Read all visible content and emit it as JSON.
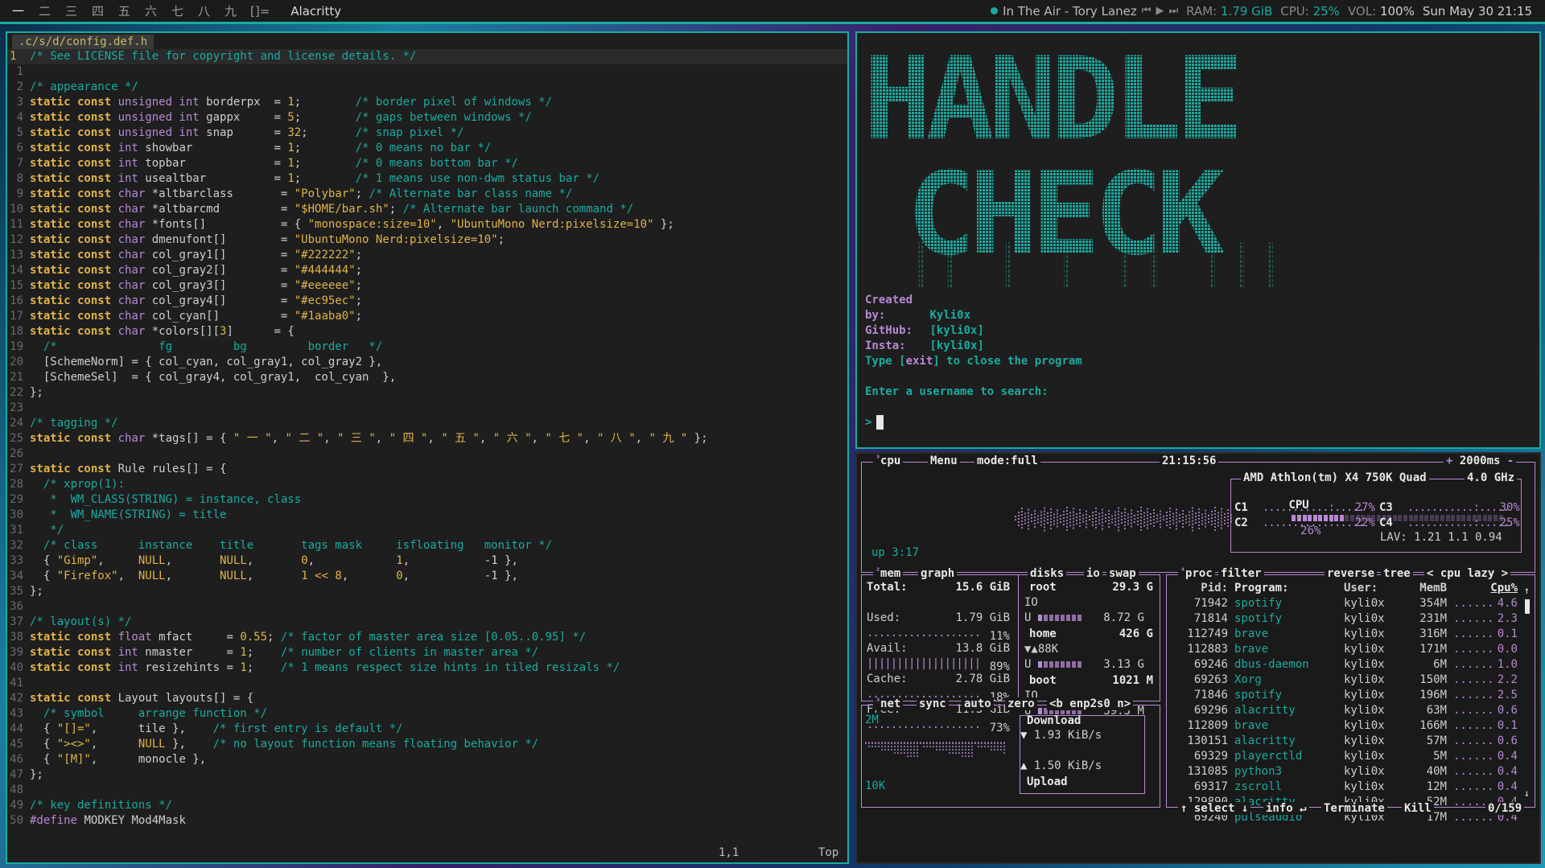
{
  "topbar": {
    "tags": [
      "一",
      "二",
      "三",
      "四",
      "五",
      "六",
      "七",
      "八",
      "九"
    ],
    "layout_symbol": "[]=",
    "window_title": "Alacritty",
    "now_playing": "In The Air - Tory Lanez",
    "ram_label": "RAM:",
    "ram_value": "1.79 GiB",
    "cpu_label": "CPU:",
    "cpu_value": "25%",
    "vol_label": "VOL:",
    "vol_value": "100%",
    "datetime": "Sun May 30 21:15"
  },
  "vim": {
    "tab": ".c/s/d/config.def.h",
    "cursor_pos": "1,1",
    "scroll": "Top",
    "lines": [
      [
        [
          "cm",
          "/* See LICENSE file for copyright and license details. */"
        ]
      ],
      [],
      [
        [
          "cm",
          "/* appearance */"
        ]
      ],
      [
        [
          "kw",
          "static const "
        ],
        [
          "ty",
          "unsigned int "
        ],
        [
          "tx",
          "borderpx  = "
        ],
        [
          "nm",
          "1"
        ],
        [
          "tx",
          ";        "
        ],
        [
          "cm",
          "/* border pixel of windows */"
        ]
      ],
      [
        [
          "kw",
          "static const "
        ],
        [
          "ty",
          "unsigned int "
        ],
        [
          "tx",
          "gappx     = "
        ],
        [
          "nm",
          "5"
        ],
        [
          "tx",
          ";        "
        ],
        [
          "cm",
          "/* gaps between windows */"
        ]
      ],
      [
        [
          "kw",
          "static const "
        ],
        [
          "ty",
          "unsigned int "
        ],
        [
          "tx",
          "snap      = "
        ],
        [
          "nm",
          "32"
        ],
        [
          "tx",
          ";       "
        ],
        [
          "cm",
          "/* snap pixel */"
        ]
      ],
      [
        [
          "kw",
          "static const "
        ],
        [
          "ty",
          "int "
        ],
        [
          "tx",
          "showbar            = "
        ],
        [
          "nm",
          "1"
        ],
        [
          "tx",
          ";        "
        ],
        [
          "cm",
          "/* 0 means no bar */"
        ]
      ],
      [
        [
          "kw",
          "static const "
        ],
        [
          "ty",
          "int "
        ],
        [
          "tx",
          "topbar             = "
        ],
        [
          "nm",
          "1"
        ],
        [
          "tx",
          ";        "
        ],
        [
          "cm",
          "/* 0 means bottom bar */"
        ]
      ],
      [
        [
          "kw",
          "static const "
        ],
        [
          "ty",
          "int "
        ],
        [
          "tx",
          "usealtbar          = "
        ],
        [
          "nm",
          "1"
        ],
        [
          "tx",
          ";        "
        ],
        [
          "cm",
          "/* 1 means use non-dwm status bar */"
        ]
      ],
      [
        [
          "kw",
          "static const "
        ],
        [
          "ty",
          "char "
        ],
        [
          "tx",
          "*altbarclass       = "
        ],
        [
          "st",
          "\"Polybar\""
        ],
        [
          "tx",
          "; "
        ],
        [
          "cm",
          "/* Alternate bar class name */"
        ]
      ],
      [
        [
          "kw",
          "static const "
        ],
        [
          "ty",
          "char "
        ],
        [
          "tx",
          "*altbarcmd         = "
        ],
        [
          "st",
          "\"$HOME/bar.sh\""
        ],
        [
          "tx",
          "; "
        ],
        [
          "cm",
          "/* Alternate bar launch command */"
        ]
      ],
      [
        [
          "kw",
          "static const "
        ],
        [
          "ty",
          "char "
        ],
        [
          "tx",
          "*fonts[]           = { "
        ],
        [
          "st",
          "\"monospace:size=10\""
        ],
        [
          "tx",
          ", "
        ],
        [
          "st",
          "\"UbuntuMono Nerd:pixelsize=10\""
        ],
        [
          "tx",
          " };"
        ]
      ],
      [
        [
          "kw",
          "static const "
        ],
        [
          "ty",
          "char "
        ],
        [
          "tx",
          "dmenufont[]        = "
        ],
        [
          "st",
          "\"UbuntuMono Nerd:pixelsize=10\""
        ],
        [
          "tx",
          ";"
        ]
      ],
      [
        [
          "kw",
          "static const "
        ],
        [
          "ty",
          "char "
        ],
        [
          "tx",
          "col_gray1[]        = "
        ],
        [
          "st",
          "\"#222222\""
        ],
        [
          "tx",
          ";"
        ]
      ],
      [
        [
          "kw",
          "static const "
        ],
        [
          "ty",
          "char "
        ],
        [
          "tx",
          "col_gray2[]        = "
        ],
        [
          "st",
          "\"#444444\""
        ],
        [
          "tx",
          ";"
        ]
      ],
      [
        [
          "kw",
          "static const "
        ],
        [
          "ty",
          "char "
        ],
        [
          "tx",
          "col_gray3[]        = "
        ],
        [
          "st",
          "\"#eeeeee\""
        ],
        [
          "tx",
          ";"
        ]
      ],
      [
        [
          "kw",
          "static const "
        ],
        [
          "ty",
          "char "
        ],
        [
          "tx",
          "col_gray4[]        = "
        ],
        [
          "st",
          "\"#ec95ec\""
        ],
        [
          "tx",
          ";"
        ]
      ],
      [
        [
          "kw",
          "static const "
        ],
        [
          "ty",
          "char "
        ],
        [
          "tx",
          "col_cyan[]         = "
        ],
        [
          "st",
          "\"#1aaba0\""
        ],
        [
          "tx",
          ";"
        ]
      ],
      [
        [
          "kw",
          "static const "
        ],
        [
          "ty",
          "char "
        ],
        [
          "tx",
          "*colors[]["
        ],
        [
          "nm",
          "3"
        ],
        [
          "tx",
          "]      = {"
        ]
      ],
      [
        [
          "cm",
          "  /*               fg         bg         border   */"
        ]
      ],
      [
        [
          "tx",
          "  [SchemeNorm] = { col_cyan, col_gray1, col_gray2 },"
        ]
      ],
      [
        [
          "tx",
          "  [SchemeSel]  = { col_gray4, col_gray1,  col_cyan  },"
        ]
      ],
      [
        [
          "tx",
          "};"
        ]
      ],
      [],
      [
        [
          "cm",
          "/* tagging */"
        ]
      ],
      [
        [
          "kw",
          "static const "
        ],
        [
          "ty",
          "char "
        ],
        [
          "tx",
          "*tags[] = { "
        ],
        [
          "st",
          "\" 一 \""
        ],
        [
          "tx",
          ", "
        ],
        [
          "st",
          "\" 二 \""
        ],
        [
          "tx",
          ", "
        ],
        [
          "st",
          "\" 三 \""
        ],
        [
          "tx",
          ", "
        ],
        [
          "st",
          "\" 四 \""
        ],
        [
          "tx",
          ", "
        ],
        [
          "st",
          "\" 五 \""
        ],
        [
          "tx",
          ", "
        ],
        [
          "st",
          "\" 六 \""
        ],
        [
          "tx",
          ", "
        ],
        [
          "st",
          "\" 七 \""
        ],
        [
          "tx",
          ", "
        ],
        [
          "st",
          "\" 八 \""
        ],
        [
          "tx",
          ", "
        ],
        [
          "st",
          "\" 九 \""
        ],
        [
          "tx",
          " };"
        ]
      ],
      [],
      [
        [
          "kw",
          "static const "
        ],
        [
          "tx",
          "Rule rules[] = {"
        ]
      ],
      [
        [
          "cm",
          "  /* xprop(1):"
        ]
      ],
      [
        [
          "cm",
          "   *  WM_CLASS(STRING) = instance, class"
        ]
      ],
      [
        [
          "cm",
          "   *  WM_NAME(STRING) = title"
        ]
      ],
      [
        [
          "cm",
          "   */"
        ]
      ],
      [
        [
          "cm",
          "  /* class      instance    title       tags mask     isfloating   monitor */"
        ]
      ],
      [
        [
          "tx",
          "  { "
        ],
        [
          "st",
          "\"Gimp\""
        ],
        [
          "tx",
          ",     "
        ],
        [
          "nm",
          "NULL"
        ],
        [
          "tx",
          ",       "
        ],
        [
          "nm",
          "NULL"
        ],
        [
          "tx",
          ",       "
        ],
        [
          "nm",
          "0"
        ],
        [
          "tx",
          ",            "
        ],
        [
          "nm",
          "1"
        ],
        [
          "tx",
          ",           -1 },"
        ]
      ],
      [
        [
          "tx",
          "  { "
        ],
        [
          "st",
          "\"Firefox\""
        ],
        [
          "tx",
          ",  "
        ],
        [
          "nm",
          "NULL"
        ],
        [
          "tx",
          ",       "
        ],
        [
          "nm",
          "NULL"
        ],
        [
          "tx",
          ",       "
        ],
        [
          "nm",
          "1 << 8"
        ],
        [
          "tx",
          ",       "
        ],
        [
          "nm",
          "0"
        ],
        [
          "tx",
          ",           -1 },"
        ]
      ],
      [
        [
          "tx",
          "};"
        ]
      ],
      [],
      [
        [
          "cm",
          "/* layout(s) */"
        ]
      ],
      [
        [
          "kw",
          "static const "
        ],
        [
          "ty",
          "float "
        ],
        [
          "tx",
          "mfact     = "
        ],
        [
          "nm",
          "0.55"
        ],
        [
          "tx",
          "; "
        ],
        [
          "cm",
          "/* factor of master area size [0.05..0.95] */"
        ]
      ],
      [
        [
          "kw",
          "static const "
        ],
        [
          "ty",
          "int "
        ],
        [
          "tx",
          "nmaster     = "
        ],
        [
          "nm",
          "1"
        ],
        [
          "tx",
          ";    "
        ],
        [
          "cm",
          "/* number of clients in master area */"
        ]
      ],
      [
        [
          "kw",
          "static const "
        ],
        [
          "ty",
          "int "
        ],
        [
          "tx",
          "resizehints = "
        ],
        [
          "nm",
          "1"
        ],
        [
          "tx",
          ";    "
        ],
        [
          "cm",
          "/* 1 means respect size hints in tiled resizals */"
        ]
      ],
      [],
      [
        [
          "kw",
          "static const "
        ],
        [
          "tx",
          "Layout layouts[] = {"
        ]
      ],
      [
        [
          "cm",
          "  /* symbol     arrange function */"
        ]
      ],
      [
        [
          "tx",
          "  { "
        ],
        [
          "st",
          "\"[]=\""
        ],
        [
          "tx",
          ",      tile },    "
        ],
        [
          "cm",
          "/* first entry is default */"
        ]
      ],
      [
        [
          "tx",
          "  { "
        ],
        [
          "st",
          "\"><>\""
        ],
        [
          "tx",
          ",      "
        ],
        [
          "nm",
          "NULL"
        ],
        [
          "tx",
          " },    "
        ],
        [
          "cm",
          "/* no layout function means floating behavior */"
        ]
      ],
      [
        [
          "tx",
          "  { "
        ],
        [
          "st",
          "\"[M]\""
        ],
        [
          "tx",
          ",      monocle },"
        ]
      ],
      [
        [
          "tx",
          "};"
        ]
      ],
      [],
      [
        [
          "cm",
          "/* key definitions */"
        ]
      ],
      [
        [
          "pp",
          "#define "
        ],
        [
          "tx",
          "MODKEY Mod4Mask"
        ]
      ]
    ]
  },
  "handle": {
    "art_line1": "HANDLE",
    "art_line2": "CHECK",
    "created_label": "Created by:",
    "created_value": "Kyli0x",
    "github_label": "GitHub:",
    "github_value": "[kyli0x]",
    "insta_label": "Insta:",
    "insta_value": "[kyli0x]",
    "exit_line_pre": "Type [",
    "exit_word": "exit",
    "exit_line_post": "] to close the program",
    "search_line": "Enter a username to search:",
    "prompt": ">"
  },
  "btop": {
    "cpu_title": "cpu",
    "menu": "Menu",
    "mode": "mode:full",
    "clock": "21:15:56",
    "refresh": "2000ms",
    "uptime": "up 3:17",
    "cpu_model": "AMD Athlon(tm) X4 750K Quad",
    "cpu_freq": "4.0 GHz",
    "cpu_total_label": "CPU",
    "cpu_total_pct": "26%",
    "cpu_total_frac": 0.26,
    "cores": [
      {
        "label": "C1",
        "pct": "27%"
      },
      {
        "label": "C3",
        "pct": "30%"
      },
      {
        "label": "C2",
        "pct": "22%"
      },
      {
        "label": "C4",
        "pct": "25%"
      }
    ],
    "lav": "LAV: 1.21 1.1 0.94",
    "mem_title": "mem",
    "graph_label": "graph",
    "mem_rows": [
      {
        "label": "Total:",
        "value": "15.6 GiB",
        "pct": ""
      },
      {
        "label": "Used:",
        "value": "1.79 GiB",
        "pct": "11%"
      },
      {
        "label": "Avail:",
        "value": "13.8 GiB",
        "pct": "89%"
      },
      {
        "label": "Cache:",
        "value": "2.78 GiB",
        "pct": "18%"
      },
      {
        "label": "Free:",
        "value": "11.3 GiB",
        "pct": "73%"
      }
    ],
    "disks_title": "disks",
    "io_label": "io",
    "swap_label": "swap",
    "disks": [
      {
        "name": "root",
        "size": "29.3 G",
        "io": "IO",
        "used": "U",
        "used_val": "8.72 G"
      },
      {
        "name": "home",
        "size": "426 G",
        "io": "▼▲88K",
        "used": "U",
        "used_val": "3.13 G"
      },
      {
        "name": "boot",
        "size": "1021 M",
        "io": "IO",
        "used": "U",
        "used_val": "59.3 M"
      }
    ],
    "net_title": "net",
    "net_sync": "sync",
    "net_auto": "auto",
    "net_zero": "zero",
    "net_iface": "<b enp2s0 n>",
    "net_top": "2M",
    "net_bottom": "10K",
    "download_label": "Download",
    "download_val": "1.93 KiB/s",
    "upload_val": "1.50 KiB/s",
    "upload_label": "Upload",
    "proc_title": "proc",
    "filter": "filter",
    "reverse": "reverse",
    "tree": "tree",
    "sort": "< cpu lazy >",
    "proc_headers": {
      "pid": "Pid:",
      "program": "Program:",
      "user": "User:",
      "mem": "MemB",
      "cpu": "Cpu%"
    },
    "procs": [
      {
        "pid": "71942",
        "name": "spotify",
        "user": "kyli0x",
        "mem": "354M",
        "cpu": "4.6"
      },
      {
        "pid": "71814",
        "name": "spotify",
        "user": "kyli0x",
        "mem": "231M",
        "cpu": "2.3"
      },
      {
        "pid": "112749",
        "name": "brave",
        "user": "kyli0x",
        "mem": "316M",
        "cpu": "0.1"
      },
      {
        "pid": "112883",
        "name": "brave",
        "user": "kyli0x",
        "mem": "171M",
        "cpu": "0.0"
      },
      {
        "pid": "69246",
        "name": "dbus-daemon",
        "user": "kyli0x",
        "mem": "6M",
        "cpu": "1.0"
      },
      {
        "pid": "69263",
        "name": "Xorg",
        "user": "kyli0x",
        "mem": "150M",
        "cpu": "2.2"
      },
      {
        "pid": "71846",
        "name": "spotify",
        "user": "kyli0x",
        "mem": "196M",
        "cpu": "2.5"
      },
      {
        "pid": "69296",
        "name": "alacritty",
        "user": "kyli0x",
        "mem": "63M",
        "cpu": "0.6"
      },
      {
        "pid": "112809",
        "name": "brave",
        "user": "kyli0x",
        "mem": "166M",
        "cpu": "0.1"
      },
      {
        "pid": "130151",
        "name": "alacritty",
        "user": "kyli0x",
        "mem": "57M",
        "cpu": "0.6"
      },
      {
        "pid": "69329",
        "name": "playerctld",
        "user": "kyli0x",
        "mem": "5M",
        "cpu": "0.4"
      },
      {
        "pid": "131085",
        "name": "python3",
        "user": "kyli0x",
        "mem": "40M",
        "cpu": "0.4"
      },
      {
        "pid": "69317",
        "name": "zscroll",
        "user": "kyli0x",
        "mem": "12M",
        "cpu": "0.4"
      },
      {
        "pid": "129890",
        "name": "alacritty",
        "user": "kyli0x",
        "mem": "52M",
        "cpu": "0.4"
      },
      {
        "pid": "69240",
        "name": "pulseaudio",
        "user": "kyli0x",
        "mem": "17M",
        "cpu": "0.4"
      }
    ],
    "footer_select": "↑ select ↓",
    "footer_info": "info ↵",
    "footer_terminate": "Terminate",
    "footer_kill": "Kill",
    "footer_count": "0/159"
  },
  "colors": {
    "accent": "#1aaba0",
    "keyword": "#e0b44a",
    "type": "#b889d4",
    "background": "#1e1e1e"
  }
}
